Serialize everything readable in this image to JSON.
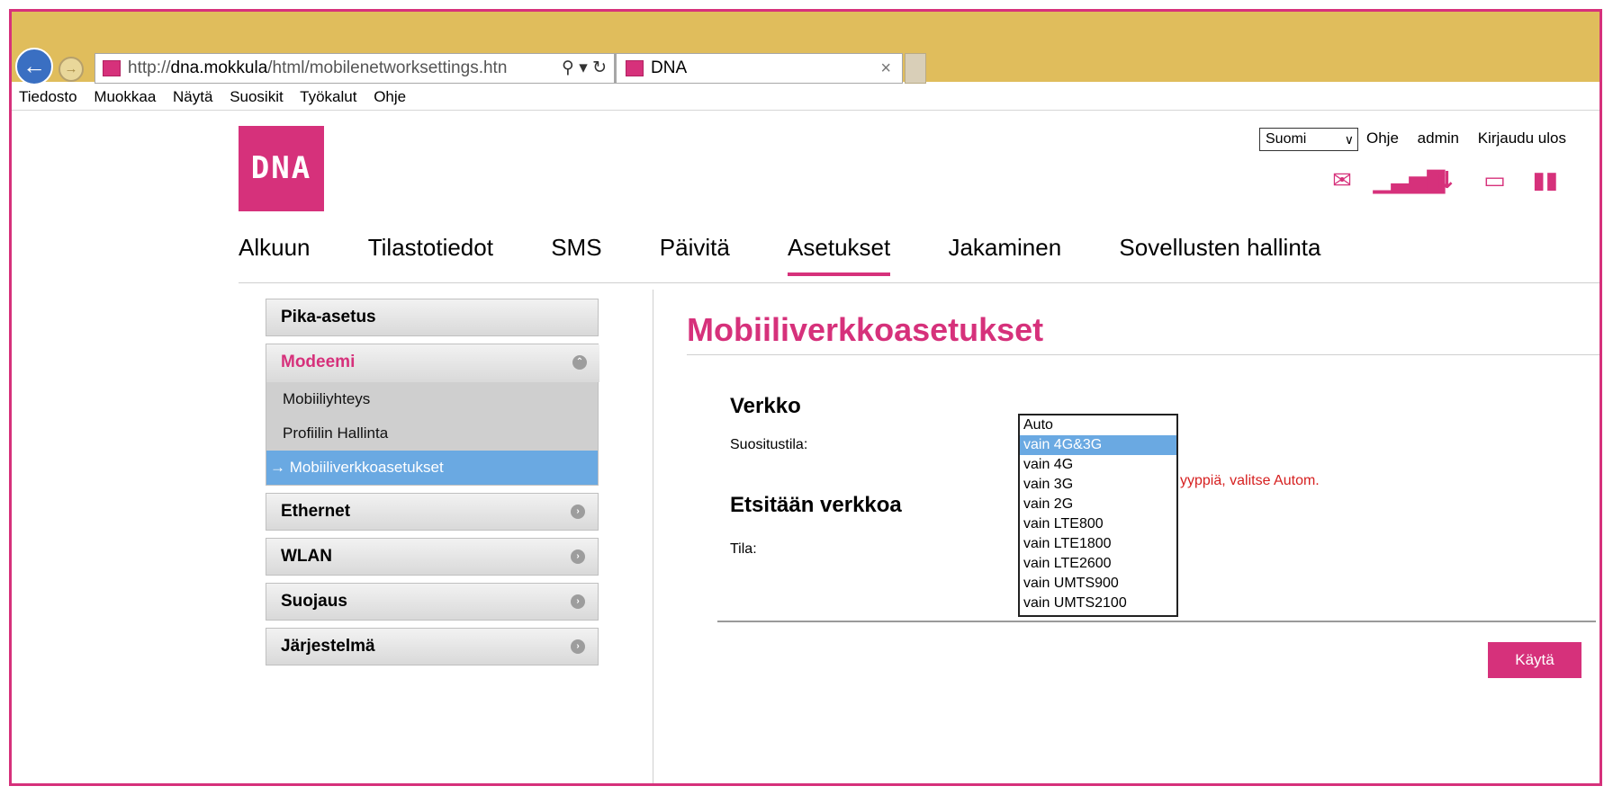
{
  "browser": {
    "url_prefix": "http://",
    "url_host": "dna.mokkula",
    "url_path": "/html/mobilenetworksettings.htn",
    "tab_title": "DNA",
    "menu": [
      "Tiedosto",
      "Muokkaa",
      "Näytä",
      "Suosikit",
      "Työkalut",
      "Ohje"
    ]
  },
  "header": {
    "logo_text": "DNA",
    "language": "Suomi",
    "links": [
      "Ohje",
      "admin",
      "Kirjaudu ulos"
    ],
    "status_icons": [
      "mail-icon",
      "signal-icon",
      "data-transfer-icon",
      "device-icon",
      "battery-icon"
    ]
  },
  "nav": {
    "items": [
      "Alkuun",
      "Tilastotiedot",
      "SMS",
      "Päivitä",
      "Asetukset",
      "Jakaminen",
      "Sovellusten hallinta"
    ],
    "active": "Asetukset"
  },
  "sidebar": {
    "quick": "Pika-asetus",
    "modem": {
      "label": "Modeemi",
      "subitems": [
        "Mobiiliyhteys",
        "Profiilin Hallinta",
        "→ Mobiiliverkkoasetukset"
      ]
    },
    "sections": [
      "Ethernet",
      "WLAN",
      "Suojaus",
      "Järjestelmä"
    ]
  },
  "main": {
    "title": "Mobiiliverkkoasetukset",
    "network_heading": "Verkko",
    "mode_label": "Suositustila:",
    "hint_text": "yyppiä, valitse Autom.",
    "search_heading": "Etsitään verkkoa",
    "state_label": "Tila:",
    "dropdown_options": [
      "Auto",
      "vain 4G&3G",
      "vain 4G",
      "vain 3G",
      "vain 2G",
      "vain LTE800",
      "vain LTE1800",
      "vain LTE2600",
      "vain UMTS900",
      "vain UMTS2100"
    ],
    "dropdown_highlighted": "vain 4G&3G",
    "apply_label": "Käytä"
  },
  "colors": {
    "brand": "#d6317b",
    "highlight": "#6aa9e2",
    "chrome": "#e0bd5c"
  }
}
